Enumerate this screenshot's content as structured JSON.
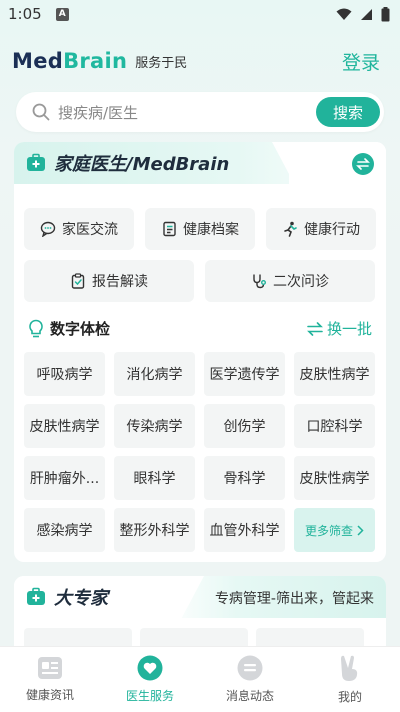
{
  "status": {
    "time": "1:05",
    "sim_label": "A"
  },
  "header": {
    "logo_part1": "Med",
    "logo_part2": "Brain",
    "slogan": "服务于民",
    "login": "登录"
  },
  "search": {
    "placeholder": "搜疾病/医生",
    "button": "搜索"
  },
  "family_doctor": {
    "title": "家庭医生/MedBrain",
    "services": [
      "家医交流",
      "健康档案",
      "健康行动",
      "报告解读",
      "二次问诊"
    ]
  },
  "digital_exam": {
    "title": "数字体检",
    "refresh": "换一批",
    "departments": [
      "呼吸病学",
      "消化病学",
      "医学遗传学",
      "皮肤性病学",
      "皮肤性病学",
      "传染病学",
      "创伤学",
      "口腔科学",
      "肝肿瘤外...",
      "眼科学",
      "骨科学",
      "皮肤性病学",
      "感染病学",
      "整形外科学",
      "血管外科学"
    ],
    "more": "更多筛查"
  },
  "experts": {
    "title": "大专家",
    "subtitle": "专病管理-筛出来，管起来"
  },
  "tabs": [
    {
      "label": "健康资讯"
    },
    {
      "label": "医生服务"
    },
    {
      "label": "消息动态"
    },
    {
      "label": "我的"
    }
  ],
  "colors": {
    "accent": "#21b39b",
    "brand_dark": "#1b2f55",
    "background": "#eef5f4"
  }
}
